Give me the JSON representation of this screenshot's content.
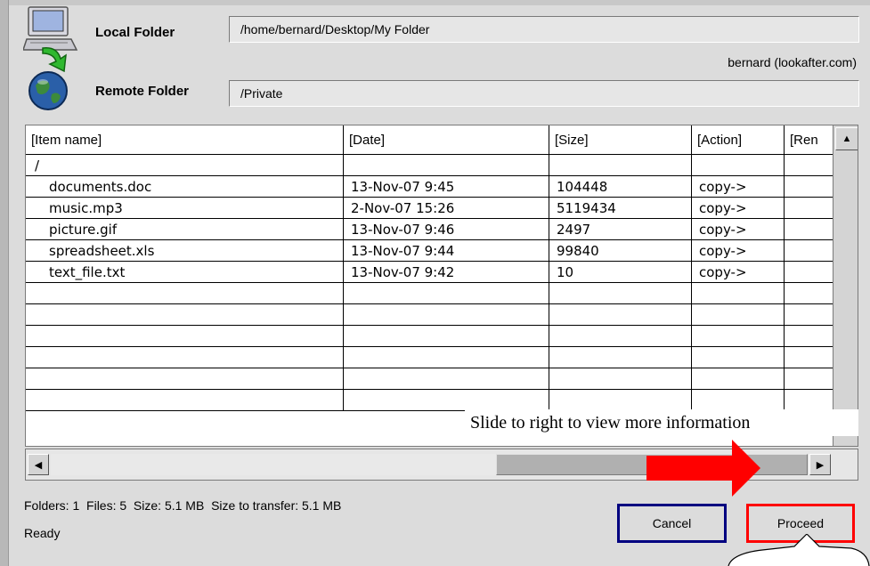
{
  "header": {
    "local_folder_label": "Local Folder",
    "local_folder_path": "/home/bernard/Desktop/My Folder",
    "remote_folder_label": "Remote Folder",
    "remote_folder_path": "/Private",
    "account": "bernard (lookafter.com)"
  },
  "table": {
    "columns": [
      "[Item name]",
      "[Date]",
      "[Size]",
      "[Action]",
      "[Ren"
    ],
    "root_row": "/",
    "rows": [
      {
        "name": "documents.doc",
        "date": "13-Nov-07 9:45",
        "size": "104448",
        "action": "copy->"
      },
      {
        "name": "music.mp3",
        "date": "2-Nov-07 15:26",
        "size": "5119434",
        "action": "copy->"
      },
      {
        "name": "picture.gif",
        "date": "13-Nov-07 9:46",
        "size": "2497",
        "action": "copy->"
      },
      {
        "name": "spreadsheet.xls",
        "date": "13-Nov-07 9:44",
        "size": "99840",
        "action": "copy->"
      },
      {
        "name": "text_file.txt",
        "date": "13-Nov-07 9:42",
        "size": "10",
        "action": "copy->"
      }
    ]
  },
  "scroll": {
    "up_icon": "arrow-up-icon",
    "left_icon": "arrow-left-icon",
    "right_icon": "arrow-right-icon"
  },
  "annotation": {
    "tip": "Slide to right to view more information",
    "arrow_color": "#ff0000"
  },
  "status": {
    "summary": "Folders: 1  Files: 5  Size: 5.1 MB  Size to transfer: 5.1 MB",
    "state": "Ready"
  },
  "buttons": {
    "cancel": "Cancel",
    "proceed": "Proceed",
    "cancel_border": "#000080",
    "proceed_border": "#ff0000"
  }
}
